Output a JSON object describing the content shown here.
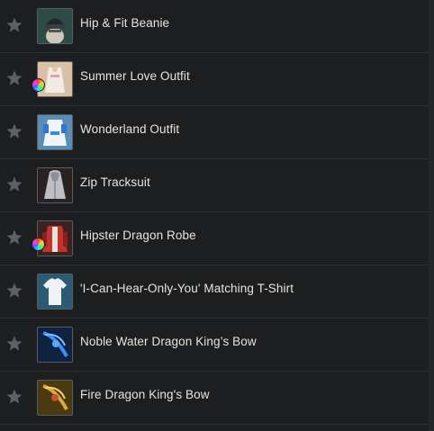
{
  "items": [
    {
      "name": "Hip & Fit Beanie",
      "icon": "beanie-icon",
      "dye": false
    },
    {
      "name": "Summer Love Outfit",
      "icon": "outfit-dress-icon",
      "dye": true
    },
    {
      "name": "Wonderland Outfit",
      "icon": "outfit-blue-icon",
      "dye": false
    },
    {
      "name": "Zip Tracksuit",
      "icon": "hoodie-icon",
      "dye": false
    },
    {
      "name": "Hipster Dragon Robe",
      "icon": "jacket-red-icon",
      "dye": true
    },
    {
      "name": "'I-Can-Hear-Only-You' Matching T-Shirt",
      "icon": "tshirt-icon",
      "dye": false
    },
    {
      "name": "Noble Water Dragon King’s Bow",
      "icon": "bow-blue-icon",
      "dye": false
    },
    {
      "name": "Fire Dragon King's Bow",
      "icon": "bow-gold-icon",
      "dye": false
    }
  ],
  "colors": {
    "background": "#1d1e20",
    "divider": "#303134",
    "text": "#e6e4dc",
    "star": "#5f6063"
  }
}
